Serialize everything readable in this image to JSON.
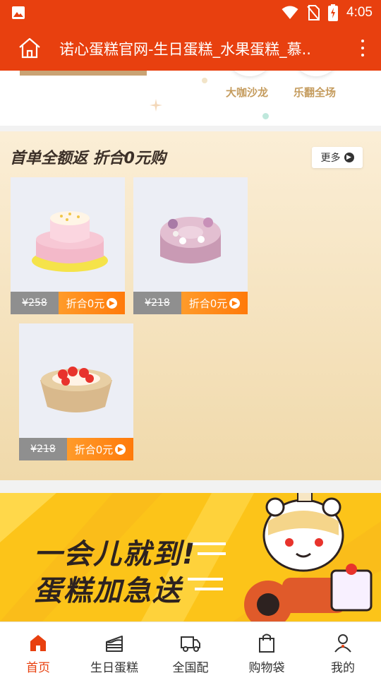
{
  "status_bar": {
    "time": "4:05"
  },
  "app_bar": {
    "title": "诺心蛋糕官网-生日蛋糕_水果蛋糕_慕.."
  },
  "categories": [
    {
      "label": "大咖沙龙"
    },
    {
      "label": "乐翻全场"
    }
  ],
  "promo": {
    "headline": "首单全额返  折合0元购",
    "more_label": "更多",
    "products": [
      {
        "price": "¥258",
        "deal_label": "折合0元"
      },
      {
        "price": "¥218",
        "deal_label": "折合0元"
      },
      {
        "price": "¥218",
        "deal_label": "折合0元"
      }
    ]
  },
  "banner": {
    "line1": "一会儿就到!",
    "line2": "蛋糕加急送"
  },
  "tabs": [
    {
      "label": "首页",
      "icon": "home-icon",
      "active": true
    },
    {
      "label": "生日蛋糕",
      "icon": "cake-icon",
      "active": false
    },
    {
      "label": "全国配",
      "icon": "truck-icon",
      "active": false
    },
    {
      "label": "购物袋",
      "icon": "shopping-bag-icon",
      "active": false
    },
    {
      "label": "我的",
      "icon": "profile-icon",
      "active": false
    }
  ],
  "colors": {
    "primary": "#e8400f",
    "deal": "#ff8a1a",
    "banner": "#fcc419"
  }
}
